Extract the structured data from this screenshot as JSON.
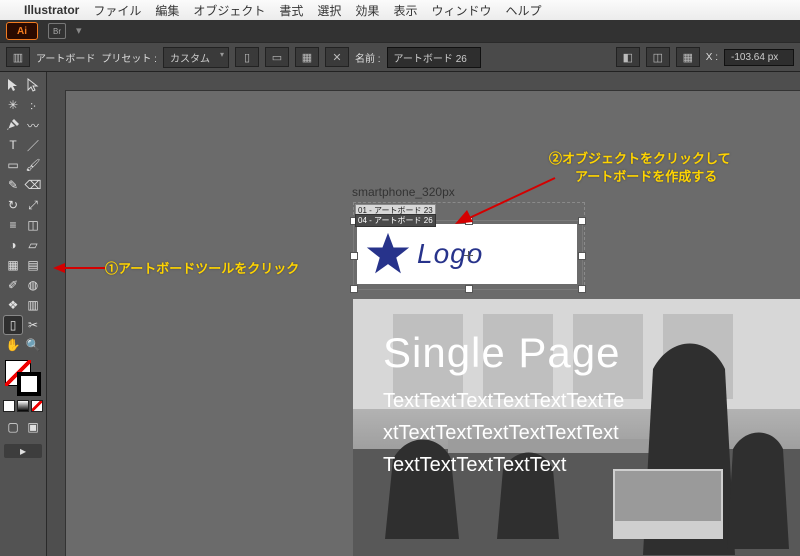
{
  "mac_menu": {
    "apple": "",
    "app": "Illustrator",
    "items": [
      "ファイル",
      "編集",
      "オブジェクト",
      "書式",
      "選択",
      "効果",
      "表示",
      "ウィンドウ",
      "ヘルプ"
    ]
  },
  "titlebar": {
    "br": "Br"
  },
  "control_bar": {
    "mode_label": "アートボード",
    "preset_label": "プリセット :",
    "preset_value": "カスタム",
    "name_label": "名前 :",
    "name_value": "アートボード 26",
    "x_label": "X :",
    "x_value": "-103.64 px"
  },
  "artboards": {
    "group_label": "smartphone_320px",
    "tag_inactive": "01 - アートボード 23",
    "tag_active": "04 - アートボード 26"
  },
  "logo": {
    "text": "Logo"
  },
  "hero": {
    "title": "Single Page",
    "line1": "TextTextTextTextTextTextTe",
    "line2": "xtTextTextTextTextTextText",
    "line3": "TextTextTextTextText"
  },
  "annotations": {
    "left": "①アートボードツールをクリック",
    "right_1": "②オブジェクトをクリックして",
    "right_2": "アートボードを作成する"
  }
}
